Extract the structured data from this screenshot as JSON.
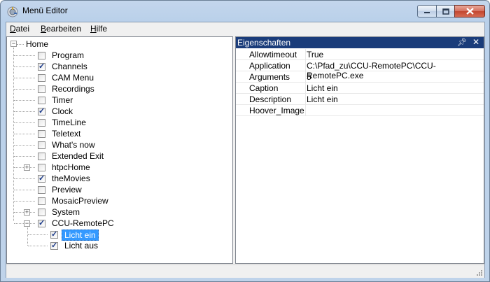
{
  "window": {
    "title": "Menü Editor"
  },
  "menubar": [
    {
      "underline": "D",
      "rest": "atei"
    },
    {
      "underline": "B",
      "rest": "earbeiten"
    },
    {
      "underline": "H",
      "rest": "ilfe"
    }
  ],
  "tree": {
    "root": "Home",
    "items": [
      {
        "label": "Program",
        "checked": false
      },
      {
        "label": "Channels",
        "checked": true
      },
      {
        "label": "CAM Menu",
        "checked": false
      },
      {
        "label": "Recordings",
        "checked": false
      },
      {
        "label": "Timer",
        "checked": false
      },
      {
        "label": "Clock",
        "checked": true
      },
      {
        "label": "TimeLine",
        "checked": false
      },
      {
        "label": "Teletext",
        "checked": false
      },
      {
        "label": "What's now",
        "checked": false
      },
      {
        "label": "Extended Exit",
        "checked": false
      },
      {
        "label": "htpcHome",
        "checked": false,
        "expandable": true
      },
      {
        "label": "theMovies",
        "checked": true
      },
      {
        "label": "Preview",
        "checked": false
      },
      {
        "label": "MosaicPreview",
        "checked": false
      },
      {
        "label": "System",
        "checked": false,
        "expandable": true
      },
      {
        "label": "CCU-RemotePC",
        "checked": true,
        "expanded": true
      }
    ],
    "children": [
      {
        "label": "Licht ein",
        "checked": true,
        "selected": true
      },
      {
        "label": "Licht aus",
        "checked": true
      }
    ]
  },
  "properties": {
    "title": "Eigenschaften",
    "rows": [
      {
        "name": "Allowtimeout",
        "value": "True"
      },
      {
        "name": "Application",
        "value": "C:\\Pfad_zu\\CCU-RemotePC\\CCU-RemotePC.exe"
      },
      {
        "name": "Arguments",
        "value": "5"
      },
      {
        "name": "Caption",
        "value": "Licht ein"
      },
      {
        "name": "Description",
        "value": "Licht ein"
      },
      {
        "name": "Hoover_Image",
        "value": ""
      }
    ]
  }
}
